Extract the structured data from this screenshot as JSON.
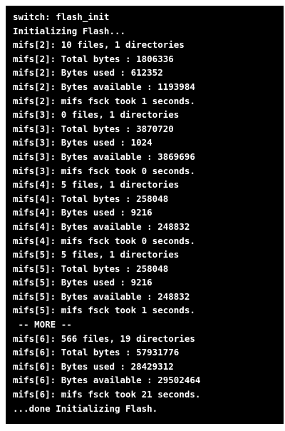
{
  "terminal": {
    "lines": [
      "switch: flash_init",
      "Initializing Flash...",
      "mifs[2]: 10 files, 1 directories",
      "mifs[2]: Total bytes : 1806336",
      "mifs[2]: Bytes used : 612352",
      "mifs[2]: Bytes available : 1193984",
      "mifs[2]: mifs fsck took 1 seconds.",
      "mifs[3]: 0 files, 1 directories",
      "mifs[3]: Total bytes : 3870720",
      "mifs[3]: Bytes used : 1024",
      "mifs[3]: Bytes available : 3869696",
      "mifs[3]: mifs fsck took 0 seconds.",
      "mifs[4]: 5 files, 1 directories",
      "mifs[4]: Total bytes : 258048",
      "mifs[4]: Bytes used : 9216",
      "mifs[4]: Bytes available : 248832",
      "mifs[4]: mifs fsck took 0 seconds.",
      "mifs[5]: 5 files, 1 directories",
      "mifs[5]: Total bytes : 258048",
      "mifs[5]: Bytes used : 9216",
      "mifs[5]: Bytes available : 248832",
      "mifs[5]: mifs fsck took 1 seconds.",
      " -- MORE --",
      "mifs[6]: 566 files, 19 directories",
      "mifs[6]: Total bytes : 57931776",
      "mifs[6]: Bytes used : 28429312",
      "mifs[6]: Bytes available : 29502464",
      "mifs[6]: mifs fsck took 21 seconds.",
      "...done Initializing Flash."
    ]
  }
}
